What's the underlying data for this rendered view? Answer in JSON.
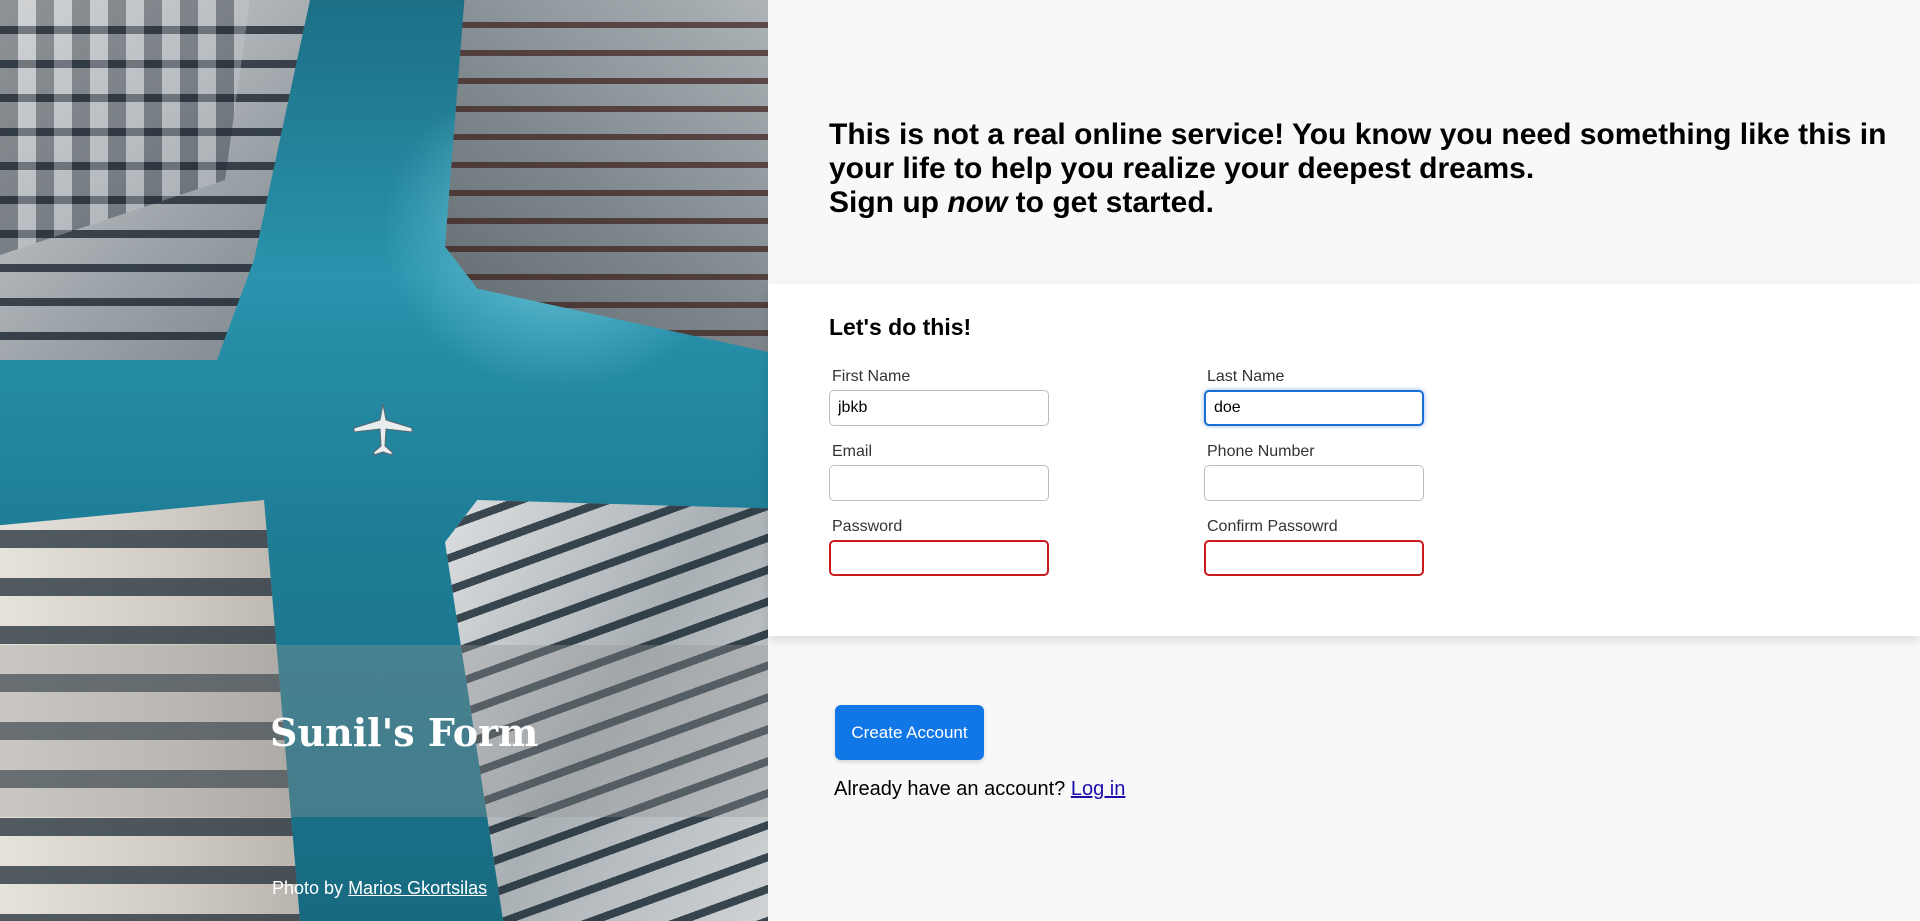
{
  "hero": {
    "title": "Sunil's Form",
    "credit_prefix": "Photo by ",
    "credit_author": "Marios Gkortsilas"
  },
  "intro": {
    "line1": "This is not a real online service! You know you need something like this in your life to help you realize your deepest dreams.",
    "line2_prefix": "Sign up ",
    "line2_emphasis": "now",
    "line2_suffix": " to get started."
  },
  "form": {
    "heading": "Let's do this!",
    "fields": {
      "first_name": {
        "label": "First Name",
        "value": "jbkb"
      },
      "last_name": {
        "label": "Last Name",
        "value": "doe"
      },
      "email": {
        "label": "Email",
        "value": ""
      },
      "phone": {
        "label": "Phone Number",
        "value": ""
      },
      "password": {
        "label": "Password",
        "value": ""
      },
      "confirm_password": {
        "label": "Confirm Passowrd",
        "value": ""
      }
    }
  },
  "actions": {
    "create_account_label": "Create Account",
    "login_prompt": "Already have an account? ",
    "login_link": "Log in"
  },
  "colors": {
    "accent": "#1177e6",
    "invalid_border": "#c81c1c",
    "focus_border": "#1a6fd6"
  }
}
